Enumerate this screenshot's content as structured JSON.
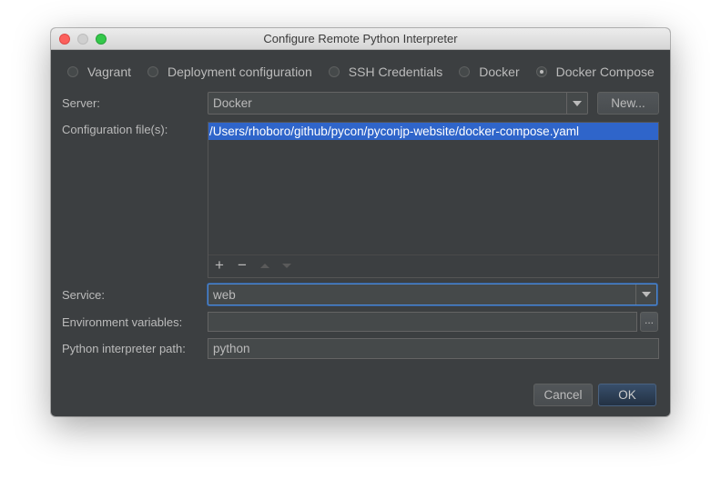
{
  "window": {
    "title": "Configure Remote Python Interpreter"
  },
  "types": [
    {
      "label": "Vagrant",
      "checked": false
    },
    {
      "label": "Deployment configuration",
      "checked": false
    },
    {
      "label": "SSH Credentials",
      "checked": false
    },
    {
      "label": "Docker",
      "checked": false
    },
    {
      "label": "Docker Compose",
      "checked": true
    }
  ],
  "server": {
    "label": "Server:",
    "value": "Docker",
    "new_button": "New..."
  },
  "config_files": {
    "label": "Configuration file(s):",
    "items": [
      "/Users/rhoboro/github/pycon/pyconjp-website/docker-compose.yaml"
    ],
    "toolbar": {
      "add": "+",
      "remove": "−"
    }
  },
  "service": {
    "label": "Service:",
    "value": "web"
  },
  "env_vars": {
    "label": "Environment variables:",
    "value": "",
    "browse": "..."
  },
  "interpreter": {
    "label": "Python interpreter path:",
    "value": "python"
  },
  "buttons": {
    "cancel": "Cancel",
    "ok": "OK"
  }
}
